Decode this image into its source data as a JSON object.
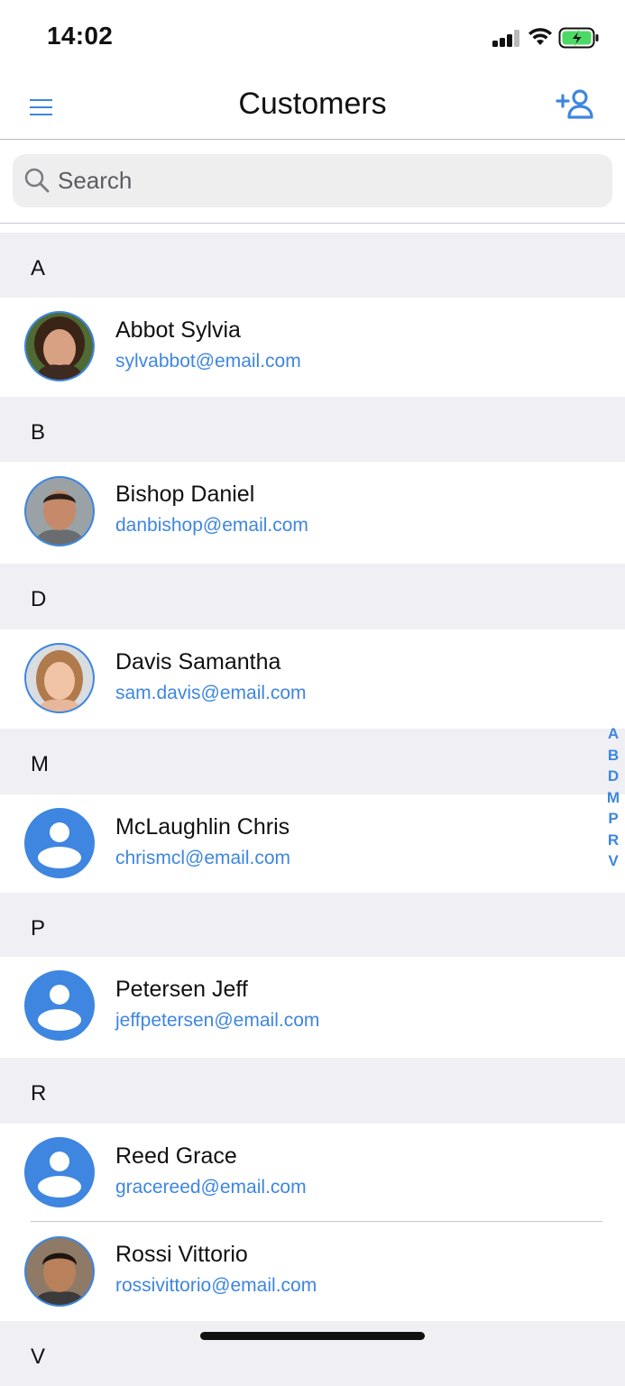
{
  "status_bar": {
    "time": "14:02"
  },
  "nav": {
    "title": "Customers",
    "menu_icon": "hamburger-icon",
    "add_icon": "add-person-icon"
  },
  "search": {
    "placeholder": "Search",
    "value": ""
  },
  "sections": [
    {
      "letter": "A",
      "rows": [
        {
          "name": "Abbot Sylvia",
          "email": "sylvabbot@email.com",
          "avatar": "photo-1"
        }
      ]
    },
    {
      "letter": "B",
      "rows": [
        {
          "name": "Bishop Daniel",
          "email": "danbishop@email.com",
          "avatar": "photo-2"
        }
      ]
    },
    {
      "letter": "D",
      "rows": [
        {
          "name": "Davis Samantha",
          "email": "sam.davis@email.com",
          "avatar": "photo-3"
        }
      ]
    },
    {
      "letter": "M",
      "rows": [
        {
          "name": "McLaughlin Chris",
          "email": "chrismcl@email.com",
          "avatar": "placeholder"
        }
      ]
    },
    {
      "letter": "P",
      "rows": [
        {
          "name": "Petersen Jeff",
          "email": "jeffpetersen@email.com",
          "avatar": "placeholder"
        }
      ]
    },
    {
      "letter": "R",
      "rows": [
        {
          "name": "Reed Grace",
          "email": "gracereed@email.com",
          "avatar": "placeholder"
        },
        {
          "name": "Rossi Vittorio",
          "email": "rossivittorio@email.com",
          "avatar": "photo-4"
        }
      ]
    },
    {
      "letter": "V",
      "rows": []
    }
  ],
  "index": [
    "A",
    "B",
    "D",
    "M",
    "P",
    "R",
    "V"
  ],
  "colors": {
    "accent": "#3e86e0",
    "section_bg": "#efeff4",
    "search_bg": "#eeeeef"
  }
}
